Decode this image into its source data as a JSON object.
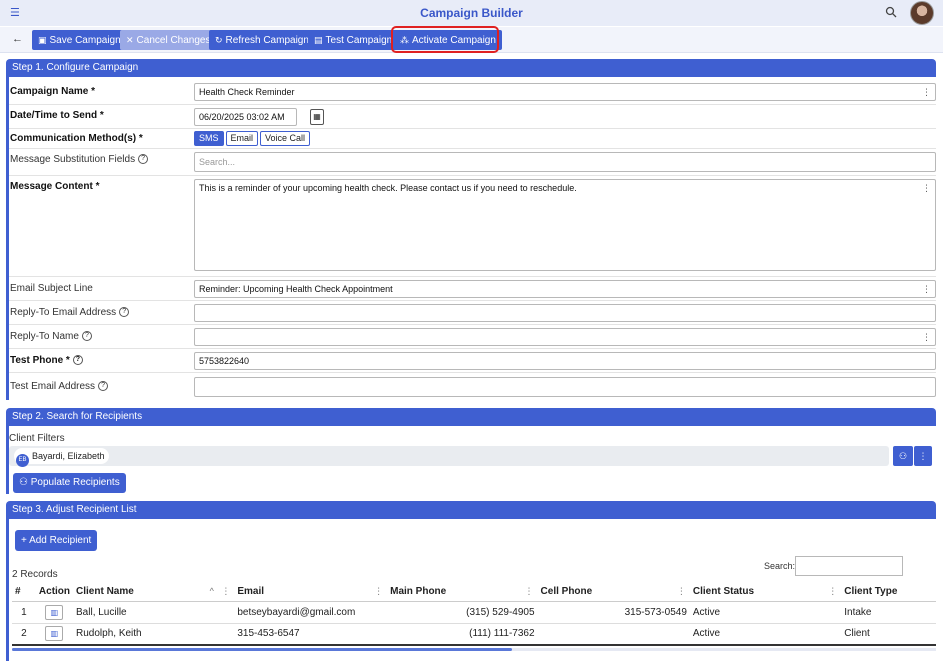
{
  "app": {
    "title": "Campaign Builder",
    "menu_icon": "menu-icon",
    "search_icon": "search-icon",
    "accent_color": "#3f5fd1"
  },
  "toolbar": {
    "back_icon": "back-arrow-icon",
    "save": "Save Campaign",
    "cancel": "Cancel Changes",
    "refresh": "Refresh Campaign",
    "test": "Test Campaign",
    "activate": "Activate Campaign",
    "highlighted": "Activate Campaign"
  },
  "step1": {
    "title": "Step 1. Configure Campaign",
    "campaign_name_label": "Campaign Name *",
    "campaign_name_value": "Health Check Reminder",
    "date_label": "Date/Time to Send *",
    "date_value": "06/20/2025 03:02 AM",
    "comm_label": "Communication Method(s) *",
    "comm_methods": [
      "SMS",
      "Email",
      "Voice Call"
    ],
    "comm_selected": "SMS",
    "subst_label": "Message Substitution Fields",
    "subst_placeholder": "Search...",
    "content_label": "Message Content *",
    "content_value": "This is a reminder of your upcoming health check. Please contact us if you need to reschedule.",
    "subject_label": "Email Subject Line",
    "subject_value": "Reminder: Upcoming Health Check Appointment",
    "reply_email_label": "Reply-To Email Address",
    "reply_email_value": "",
    "reply_name_label": "Reply-To Name",
    "reply_name_value": "",
    "test_phone_label": "Test Phone *",
    "test_phone_value": "5753822640",
    "test_email_label": "Test Email Address",
    "test_email_value": ""
  },
  "step2": {
    "title": "Step 2. Search for Recipients",
    "filters_label": "Client Filters",
    "filter_chip_initials": "EB",
    "filter_chip_name": "Bayardi, Elizabeth",
    "populate": "Populate Recipients"
  },
  "step3": {
    "title": "Step 3. Adjust Recipient List",
    "add": "+ Add Recipient",
    "search_label": "Search:",
    "records": "2 Records",
    "columns": [
      "#",
      "Action",
      "Client Name",
      "Email",
      "Main Phone",
      "Cell Phone",
      "Client Status",
      "Client Type"
    ],
    "rows": [
      {
        "num": "1",
        "name": "Ball, Lucille",
        "email": "betseybayardi@gmail.com",
        "main": "(315) 529-4905",
        "cell": "315-573-0549",
        "status": "Active",
        "type": "Intake"
      },
      {
        "num": "2",
        "name": "Rudolph, Keith",
        "email": "315-453-6547",
        "main": "(111) 111-7362",
        "cell": "",
        "status": "Active",
        "type": "Client"
      }
    ]
  }
}
